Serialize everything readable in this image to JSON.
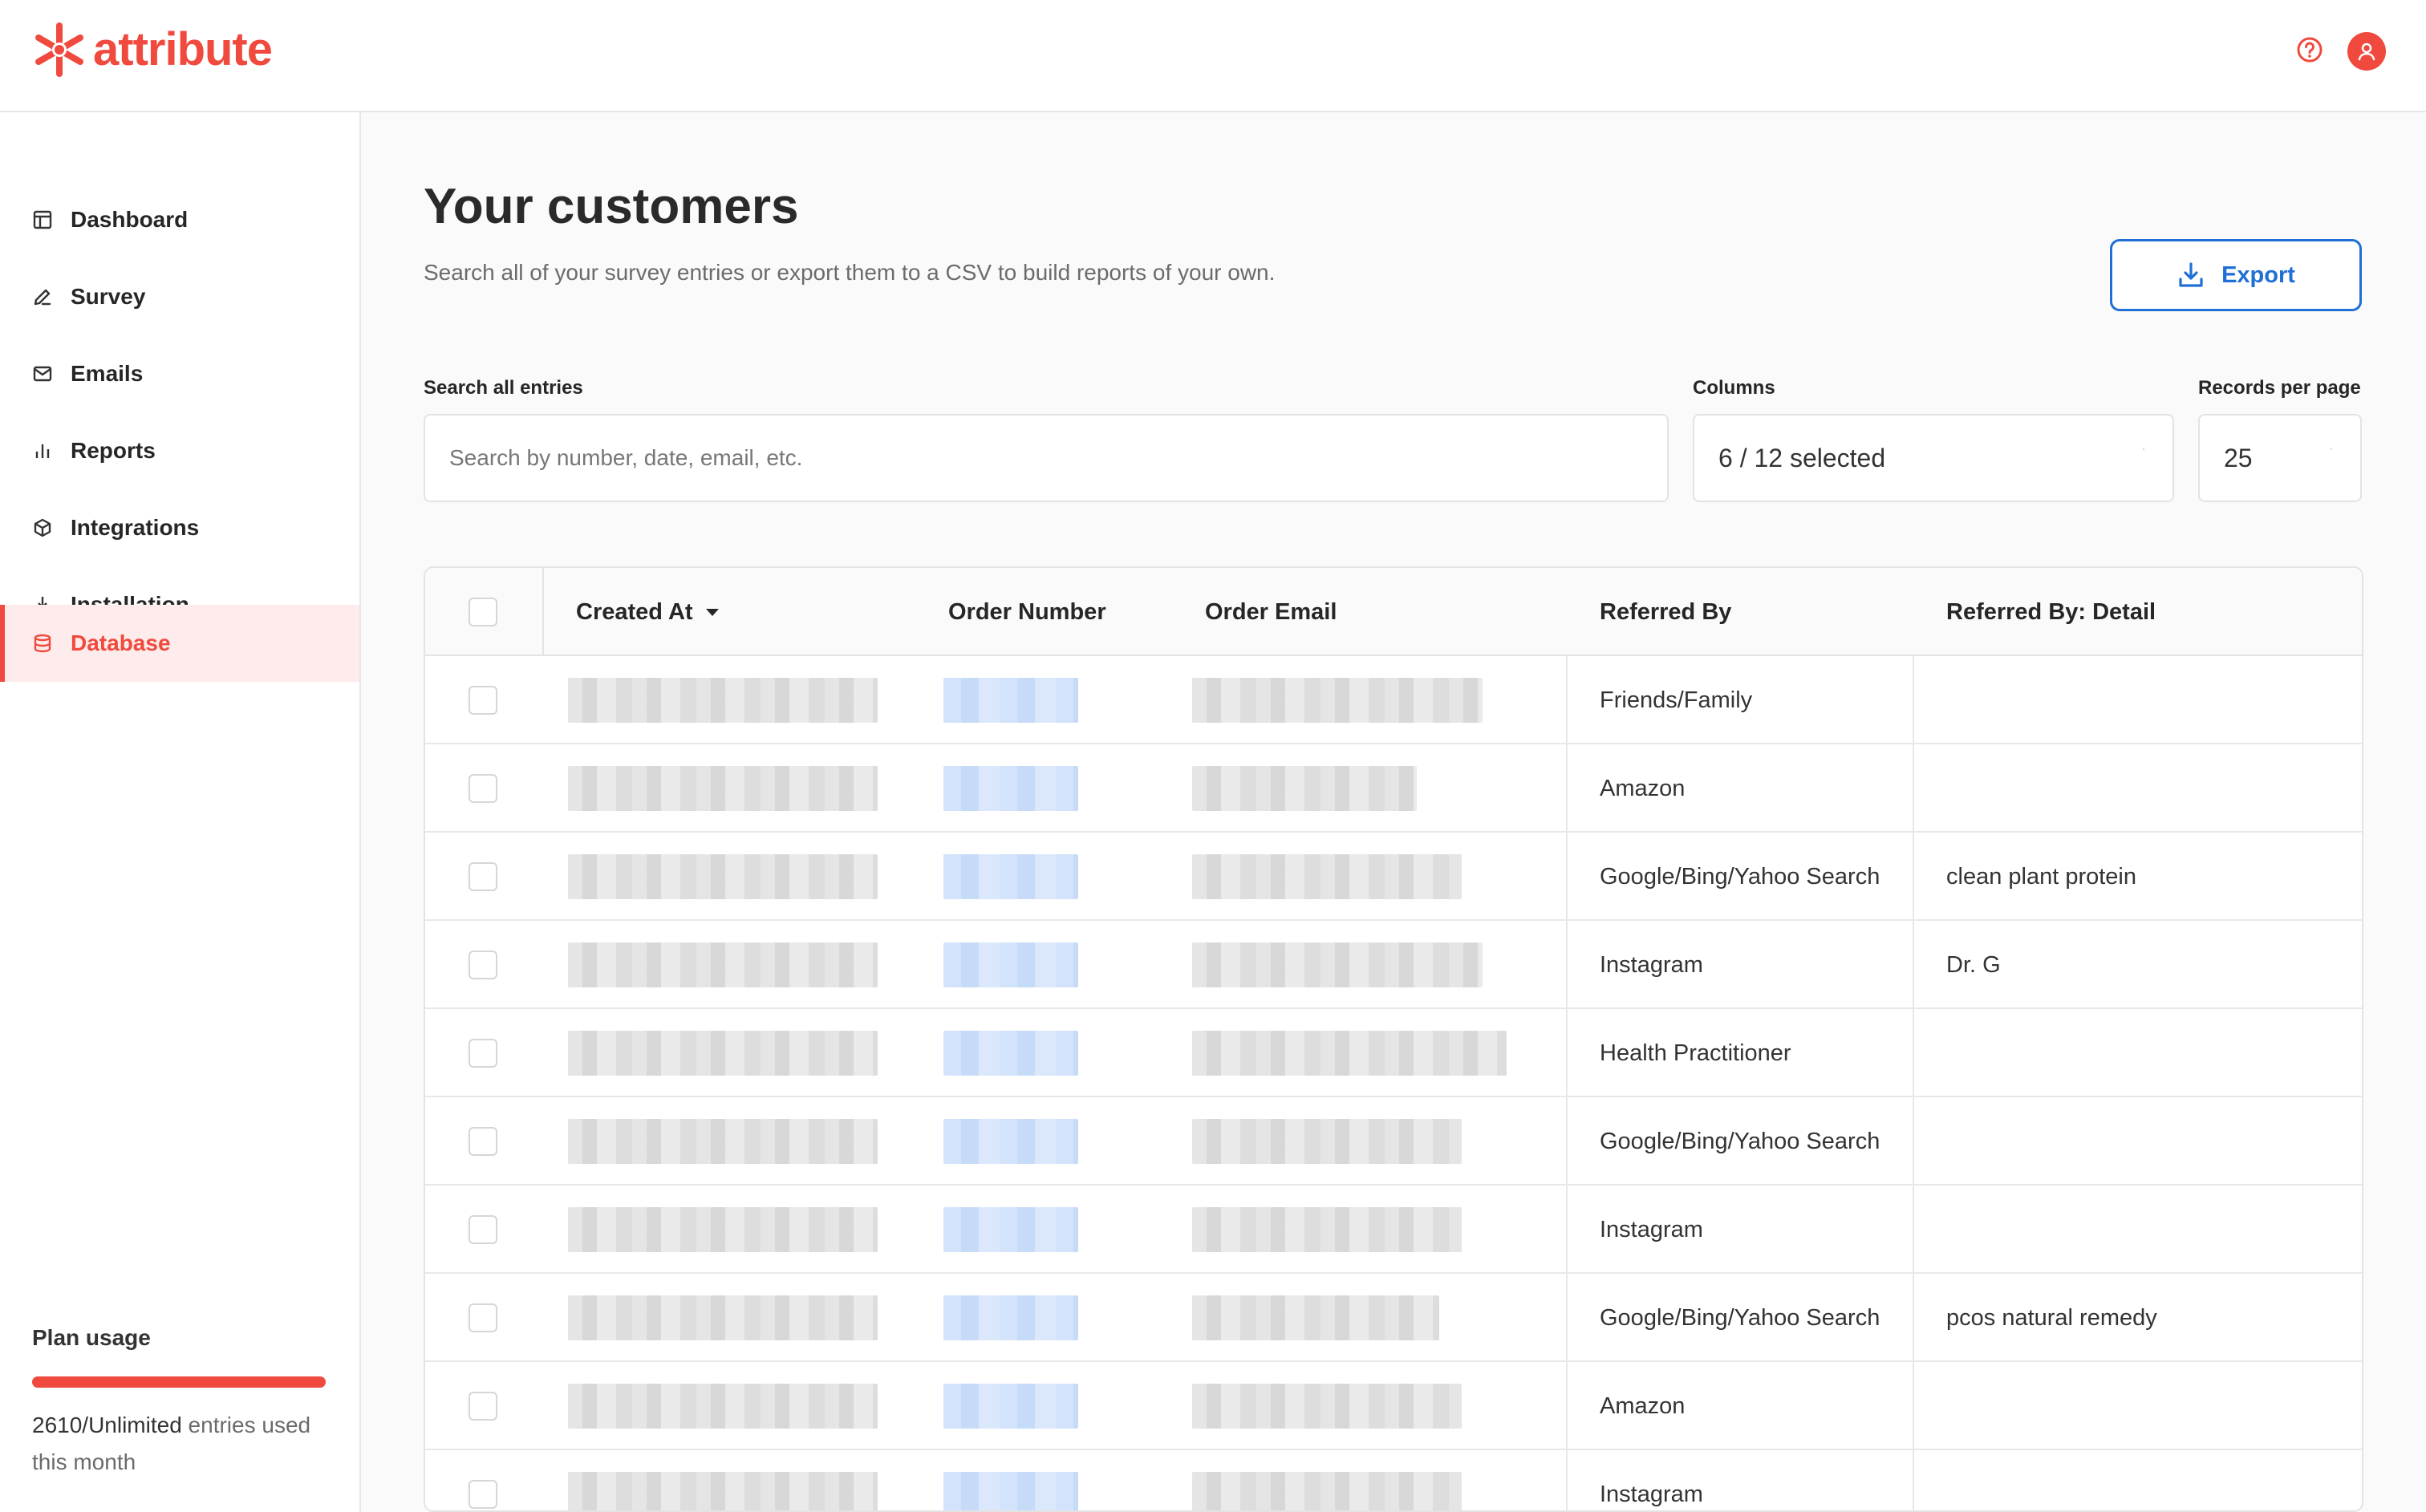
{
  "app": {
    "name": "attribute",
    "brand_color": "#f04a3e",
    "accent_color": "#1f6fd6"
  },
  "header": {
    "help_icon": "question-circle-icon",
    "avatar_icon": "user-icon"
  },
  "sidebar": {
    "items": [
      {
        "label": "Dashboard",
        "icon": "layout-icon",
        "active": false
      },
      {
        "label": "Survey",
        "icon": "pencil-icon",
        "active": false
      },
      {
        "label": "Emails",
        "icon": "mail-icon",
        "active": false
      },
      {
        "label": "Reports",
        "icon": "bar-chart-icon",
        "active": false
      },
      {
        "label": "Integrations",
        "icon": "cube-icon",
        "active": false
      },
      {
        "label": "Installation",
        "icon": "download-icon",
        "active": false
      },
      {
        "label": "Database",
        "icon": "database-icon",
        "active": true
      }
    ],
    "plan": {
      "title": "Plan usage",
      "usage_value": "2610/Unlimited",
      "usage_suffix": " entries used this month",
      "fill_fraction": 1.0
    }
  },
  "main": {
    "title": "Your customers",
    "subtitle": "Search all of your survey entries or export them to a CSV to build reports of your own.",
    "export_label": "Export",
    "search": {
      "label": "Search all entries",
      "placeholder": "Search by number, date, email, etc.",
      "value": ""
    },
    "columns": {
      "label": "Columns",
      "value": "6 / 12 selected"
    },
    "records": {
      "label": "Records per page",
      "value": "25"
    }
  },
  "table": {
    "headers": [
      "Created At",
      "Order Number",
      "Order Email",
      "Referred By",
      "Referred By: Detail"
    ],
    "sort_column": "Created At",
    "rows": [
      {
        "referred_by": "Friends/Family",
        "detail": ""
      },
      {
        "referred_by": "Amazon",
        "detail": ""
      },
      {
        "referred_by": "Google/Bing/Yahoo Search",
        "detail": "clean plant protein"
      },
      {
        "referred_by": "Instagram",
        "detail": "Dr. G"
      },
      {
        "referred_by": "Health Practitioner",
        "detail": ""
      },
      {
        "referred_by": "Google/Bing/Yahoo Search",
        "detail": ""
      },
      {
        "referred_by": "Instagram",
        "detail": ""
      },
      {
        "referred_by": "Google/Bing/Yahoo Search",
        "detail": "pcos natural remedy"
      },
      {
        "referred_by": "Amazon",
        "detail": ""
      },
      {
        "referred_by": "Instagram",
        "detail": ""
      }
    ]
  }
}
